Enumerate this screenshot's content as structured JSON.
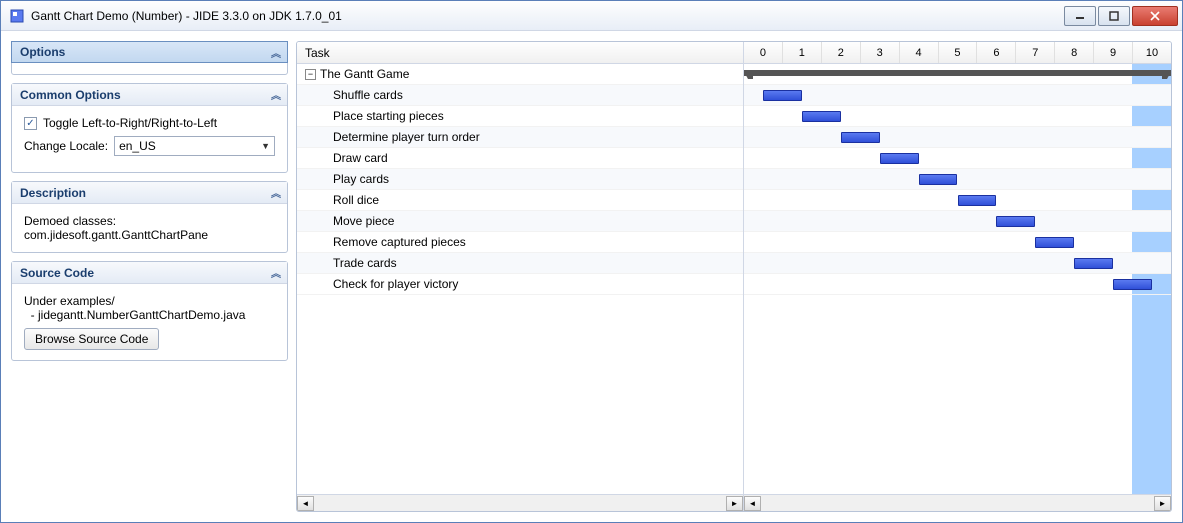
{
  "window": {
    "title": "Gantt Chart Demo (Number) - JIDE 3.3.0 on JDK 1.7.0_01"
  },
  "sidebar": {
    "options": {
      "title": "Options"
    },
    "common": {
      "title": "Common Options",
      "toggle_label": "Toggle Left-to-Right/Right-to-Left",
      "toggle_checked": true,
      "locale_label": "Change Locale:",
      "locale_value": "en_US"
    },
    "description": {
      "title": "Description",
      "label": "Demoed classes:",
      "classes": "com.jidesoft.gantt.GanttChartPane"
    },
    "source": {
      "title": "Source Code",
      "path_label": "Under examples/",
      "path_item": "  - jidegantt.NumberGanttChartDemo.java",
      "browse_button": "Browse Source Code"
    }
  },
  "gantt": {
    "task_header": "Task",
    "timeline_ticks": [
      "0",
      "1",
      "2",
      "3",
      "4",
      "5",
      "6",
      "7",
      "8",
      "9",
      "10"
    ],
    "root_task": "The Gantt Game",
    "tasks": [
      "Shuffle cards",
      "Place starting pieces",
      "Determine player turn order",
      "Draw card",
      "Play cards",
      "Roll dice",
      "Move piece",
      "Remove captured pieces",
      "Trade cards",
      "Check for player victory"
    ]
  },
  "chart_data": {
    "type": "gantt",
    "xlabel": "",
    "xlim": [
      0,
      11
    ],
    "ticks": [
      0,
      1,
      2,
      3,
      4,
      5,
      6,
      7,
      8,
      9,
      10
    ],
    "highlight_range": [
      10,
      11
    ],
    "series": [
      {
        "name": "The Gantt Game",
        "start": 0,
        "end": 11,
        "kind": "summary"
      },
      {
        "name": "Shuffle cards",
        "start": 0.5,
        "end": 1.5,
        "kind": "task"
      },
      {
        "name": "Place starting pieces",
        "start": 1.5,
        "end": 2.5,
        "kind": "task"
      },
      {
        "name": "Determine player turn order",
        "start": 2.5,
        "end": 3.5,
        "kind": "task"
      },
      {
        "name": "Draw card",
        "start": 3.5,
        "end": 4.5,
        "kind": "task"
      },
      {
        "name": "Play cards",
        "start": 4.5,
        "end": 5.5,
        "kind": "task"
      },
      {
        "name": "Roll dice",
        "start": 5.5,
        "end": 6.5,
        "kind": "task"
      },
      {
        "name": "Move piece",
        "start": 6.5,
        "end": 7.5,
        "kind": "task"
      },
      {
        "name": "Remove captured pieces",
        "start": 7.5,
        "end": 8.5,
        "kind": "task"
      },
      {
        "name": "Trade cards",
        "start": 8.5,
        "end": 9.5,
        "kind": "task"
      },
      {
        "name": "Check for player victory",
        "start": 9.5,
        "end": 10.5,
        "kind": "task"
      }
    ]
  }
}
